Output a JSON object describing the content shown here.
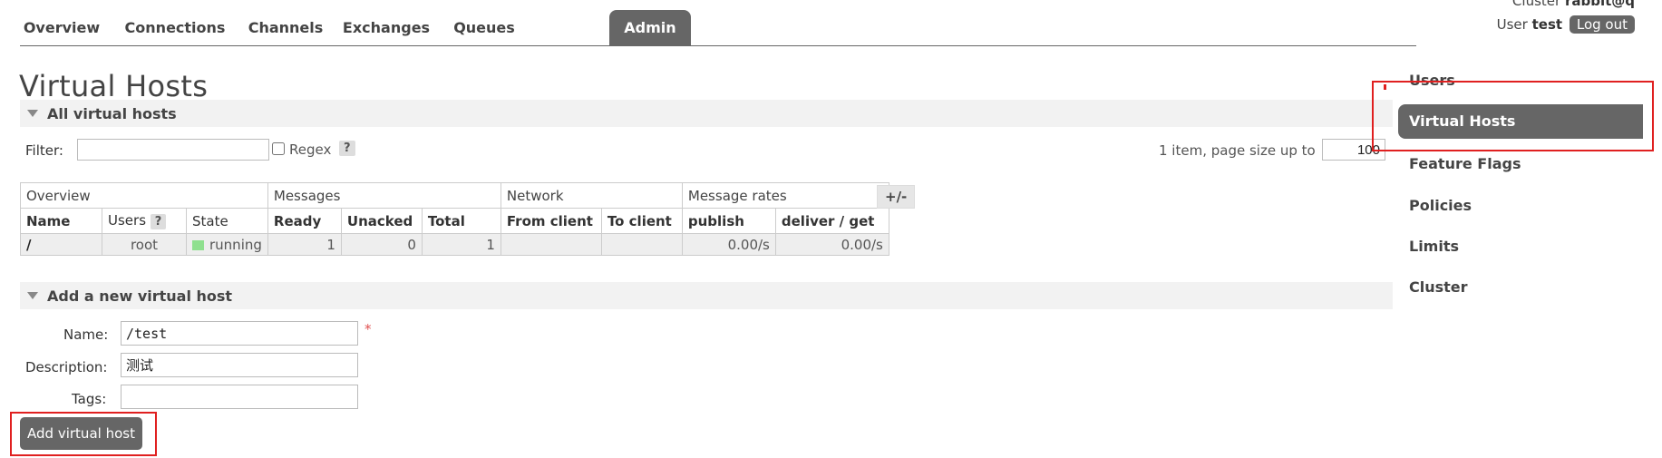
{
  "nav": {
    "tabs": [
      "Overview",
      "Connections",
      "Channels",
      "Exchanges",
      "Queues",
      "Admin"
    ],
    "active": "Admin"
  },
  "header": {
    "cluster_label": "Cluster",
    "cluster_value": "rabbit@q",
    "user_label": "User",
    "user_value": "test",
    "logout_label": "Log out"
  },
  "page": {
    "title": "Virtual Hosts"
  },
  "all_vhosts": {
    "section_title": "All virtual hosts",
    "filter_label": "Filter:",
    "filter_value": "",
    "regex_label": "Regex",
    "help_label": "?",
    "pagination_text": "1 item, page size up to",
    "page_size": "100",
    "plus_minus": "+/-"
  },
  "table": {
    "groups": [
      "Overview",
      "Messages",
      "Network",
      "Message rates"
    ],
    "columns": [
      "Name",
      "Users",
      "State",
      "Ready",
      "Unacked",
      "Total",
      "From client",
      "To client",
      "publish",
      "deliver / get"
    ],
    "users_help": "?",
    "rows": [
      {
        "name": "/",
        "users": "root",
        "state": "running",
        "ready": "1",
        "unacked": "0",
        "total": "1",
        "from_client": "",
        "to_client": "",
        "publish": "0.00/s",
        "deliver_get": "0.00/s"
      }
    ]
  },
  "add_vhost": {
    "section_title": "Add a new virtual host",
    "name_label": "Name:",
    "name_value": "/test",
    "required_mark": "*",
    "description_label": "Description:",
    "description_value": "测试",
    "tags_label": "Tags:",
    "tags_value": "",
    "submit_label": "Add virtual host"
  },
  "sidebar": {
    "items": [
      "Users",
      "Virtual Hosts",
      "Feature Flags",
      "Policies",
      "Limits",
      "Cluster"
    ],
    "active": "Virtual Hosts"
  },
  "colors": {
    "nav_active_bg": "#666666",
    "section_bg": "#f2f2f2",
    "running": "#8fe08f",
    "annotation_red": "#e02020"
  }
}
